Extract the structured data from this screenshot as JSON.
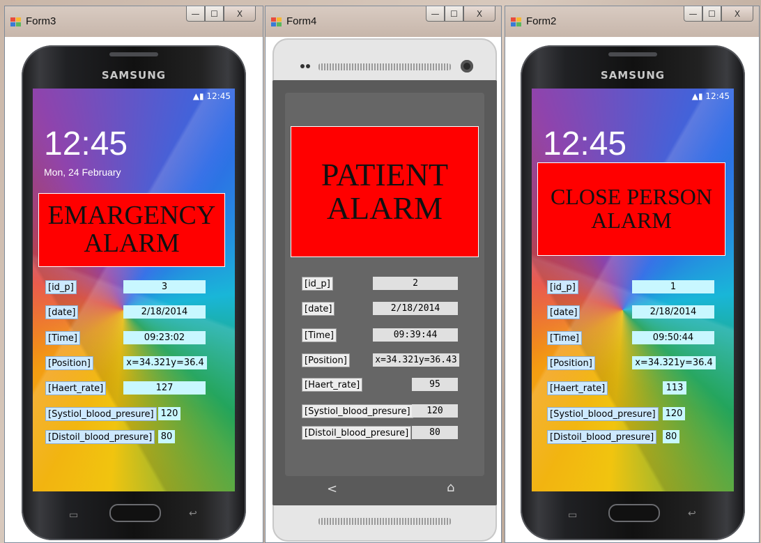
{
  "windows": [
    {
      "title": "Form3",
      "phone_brand": "SAMSUNG",
      "status_time": "12:45",
      "lock_clock": "12:45",
      "lock_date": "Mon, 24 February",
      "alarm": [
        "EMARGENCY",
        "ALARM"
      ],
      "fields": [
        {
          "label": "[id_p]",
          "value": "3"
        },
        {
          "label": "[date]",
          "value": "2/18/2014"
        },
        {
          "label": "[Time]",
          "value": "09:23:02"
        },
        {
          "label": "[Position]",
          "value": "x=34.321y=36.4"
        },
        {
          "label": "[Haert_rate]",
          "value": "127"
        },
        {
          "label": "[Systiol_blood_presure]",
          "value": "120"
        },
        {
          "label": "[Distoil_blood_presure]",
          "value": "80"
        }
      ]
    },
    {
      "title": "Form4",
      "alarm": [
        "PATIENT",
        "ALARM"
      ],
      "fields": [
        {
          "label": "[id_p]",
          "value": "2"
        },
        {
          "label": "[date]",
          "value": "2/18/2014"
        },
        {
          "label": "[Time]",
          "value": "09:39:44"
        },
        {
          "label": "[Position]",
          "value": "x=34.321y=36.43"
        },
        {
          "label": "[Haert_rate]",
          "value": "95"
        },
        {
          "label": "[Systiol_blood_presure]",
          "value": "120"
        },
        {
          "label": "[Distoil_blood_presure]",
          "value": "80"
        }
      ],
      "nav_back": "<",
      "nav_home": "⌂"
    },
    {
      "title": "Form2",
      "phone_brand": "SAMSUNG",
      "status_time": "12:45",
      "lock_clock": "12:45",
      "alarm": [
        "CLOSE PERSON",
        "ALARM"
      ],
      "fields": [
        {
          "label": "[id_p]",
          "value": "1"
        },
        {
          "label": "[date]",
          "value": "2/18/2014"
        },
        {
          "label": "[Time]",
          "value": "09:50:44"
        },
        {
          "label": "[Position]",
          "value": "x=34.321y=36.4"
        },
        {
          "label": "[Haert_rate]",
          "value": "113"
        },
        {
          "label": "[Systiol_blood_presure]",
          "value": "120"
        },
        {
          "label": "[Distoil_blood_presure]",
          "value": "80"
        }
      ]
    }
  ],
  "window_controls": {
    "minimize": "—",
    "maximize": "☐",
    "close": "X"
  }
}
